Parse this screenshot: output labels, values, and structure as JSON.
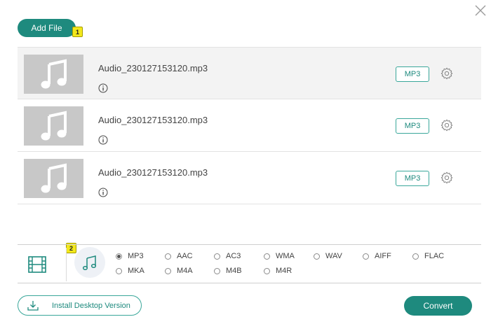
{
  "toolbar": {
    "add_file_label": "Add File",
    "badge_1": "1"
  },
  "files": [
    {
      "name": "Audio_230127153120.mp3",
      "format": "MP3"
    },
    {
      "name": "Audio_230127153120.mp3",
      "format": "MP3"
    },
    {
      "name": "Audio_230127153120.mp3",
      "format": "MP3"
    }
  ],
  "format_panel": {
    "badge_2": "2",
    "selected": "MP3",
    "options": [
      "MP3",
      "AAC",
      "AC3",
      "WMA",
      "WAV",
      "AIFF",
      "FLAC",
      "MKA",
      "M4A",
      "M4B",
      "M4R"
    ]
  },
  "footer": {
    "install_label": "Install Desktop Version",
    "convert_label": "Convert"
  },
  "colors": {
    "accent": "#1e8a7e",
    "thumb_bg": "#c8c8c8",
    "badge": "#f3e81c"
  }
}
